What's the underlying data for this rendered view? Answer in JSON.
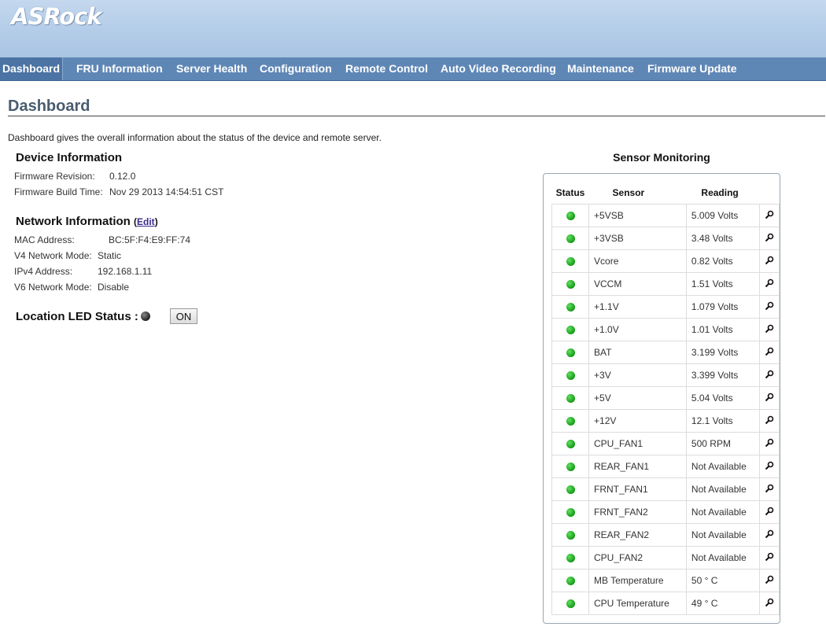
{
  "header": {
    "logo": "ASRock"
  },
  "nav": [
    {
      "label": "Dashboard",
      "active": true
    },
    {
      "label": "FRU Information",
      "active": false
    },
    {
      "label": "Server Health",
      "active": false
    },
    {
      "label": "Configuration",
      "active": false
    },
    {
      "label": "Remote Control",
      "active": false
    },
    {
      "label": "Auto Video Recording",
      "active": false
    },
    {
      "label": "Maintenance",
      "active": false
    },
    {
      "label": "Firmware Update",
      "active": false
    }
  ],
  "page": {
    "title": "Dashboard",
    "intro": "Dashboard gives the overall information about the status of the device and remote server."
  },
  "device_info": {
    "heading": "Device Information",
    "fw_rev_label": "Firmware Revision:",
    "fw_rev_value": "0.12.0",
    "fw_build_label": "Firmware Build Time:",
    "fw_build_value": "Nov 29 2013 14:54:51 CST"
  },
  "network_info": {
    "heading": "Network Information",
    "paren_open": "(",
    "edit_link": "Edit",
    "paren_close": ")",
    "mac_label": "MAC Address:",
    "mac_value": "BC:5F:F4:E9:FF:74",
    "v4_mode_label": "V4 Network Mode:",
    "v4_mode_value": "Static",
    "ipv4_label": "IPv4 Address:",
    "ipv4_value": "192.168.1.11",
    "v6_mode_label": "V6 Network Mode:",
    "v6_mode_value": "Disable"
  },
  "location_led": {
    "label": "Location LED Status :",
    "button": "ON"
  },
  "sensors": {
    "title": "Sensor Monitoring",
    "col_status": "Status",
    "col_sensor": "Sensor",
    "col_reading": "Reading",
    "status_color": "#1fa71f",
    "rows": [
      {
        "name": "+5VSB",
        "reading": "5.009 Volts"
      },
      {
        "name": "+3VSB",
        "reading": "3.48 Volts"
      },
      {
        "name": "Vcore",
        "reading": "0.82 Volts"
      },
      {
        "name": "VCCM",
        "reading": "1.51 Volts"
      },
      {
        "name": "+1.1V",
        "reading": "1.079 Volts"
      },
      {
        "name": "+1.0V",
        "reading": "1.01 Volts"
      },
      {
        "name": "BAT",
        "reading": "3.199 Volts"
      },
      {
        "name": "+3V",
        "reading": "3.399 Volts"
      },
      {
        "name": "+5V",
        "reading": "5.04 Volts"
      },
      {
        "name": "+12V",
        "reading": "12.1 Volts"
      },
      {
        "name": "CPU_FAN1",
        "reading": "500 RPM"
      },
      {
        "name": "REAR_FAN1",
        "reading": "Not Available"
      },
      {
        "name": "FRNT_FAN1",
        "reading": "Not Available"
      },
      {
        "name": "FRNT_FAN2",
        "reading": "Not Available"
      },
      {
        "name": "REAR_FAN2",
        "reading": "Not Available"
      },
      {
        "name": "CPU_FAN2",
        "reading": "Not Available"
      },
      {
        "name": "MB Temperature",
        "reading": "50 ° C"
      },
      {
        "name": "CPU Temperature",
        "reading": "49 ° C"
      }
    ]
  }
}
